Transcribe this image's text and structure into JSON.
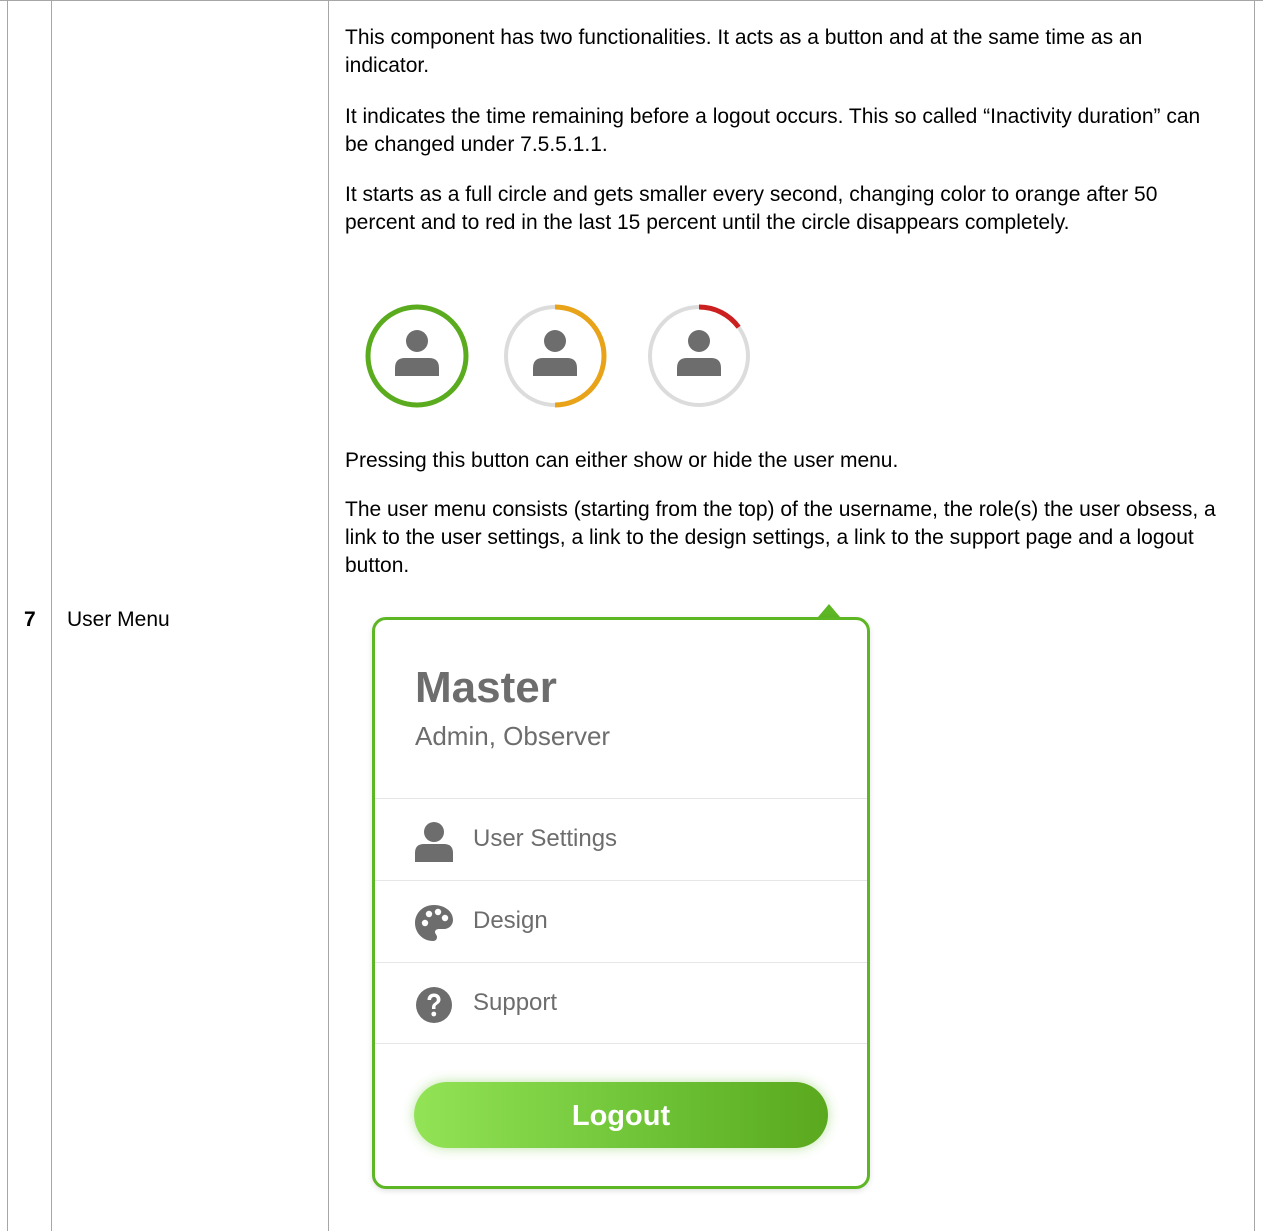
{
  "row": {
    "number": "7",
    "name": "User Menu"
  },
  "paragraphs": {
    "p1": "This component has two functionalities. It acts as a button and at the same time as an indicator.",
    "p2": "It indicates the time remaining before a logout occurs. This so called “Inactivity duration” can be changed under 7.5.5.1.1.",
    "p3": "It starts as a full circle and gets smaller every second, changing color to orange after 50 percent and to red in the last 15 percent until the circle disappears completely.",
    "p4": "Pressing this button can either show or hide the user menu.",
    "p5": "The user menu consists (starting from the top) of the username, the role(s) the user obsess, a link to the user settings, a link to the design settings, a link to the support page and a logout button."
  },
  "timers": [
    {
      "remaining_fraction": 1.0,
      "color": "#5aab1e"
    },
    {
      "remaining_fraction": 0.5,
      "color": "#e8a319"
    },
    {
      "remaining_fraction": 0.15,
      "color": "#cc1f1f"
    }
  ],
  "colors": {
    "track": "#dcdcdc",
    "avatar": "#6d6d6d",
    "accent": "#5db624"
  },
  "user_menu": {
    "username": "Master",
    "roles": "Admin, Observer",
    "items": [
      {
        "label": "User Settings",
        "icon": "user-icon"
      },
      {
        "label": "Design",
        "icon": "palette-icon"
      },
      {
        "label": "Support",
        "icon": "question-circle-icon"
      }
    ],
    "logout_label": "Logout"
  }
}
